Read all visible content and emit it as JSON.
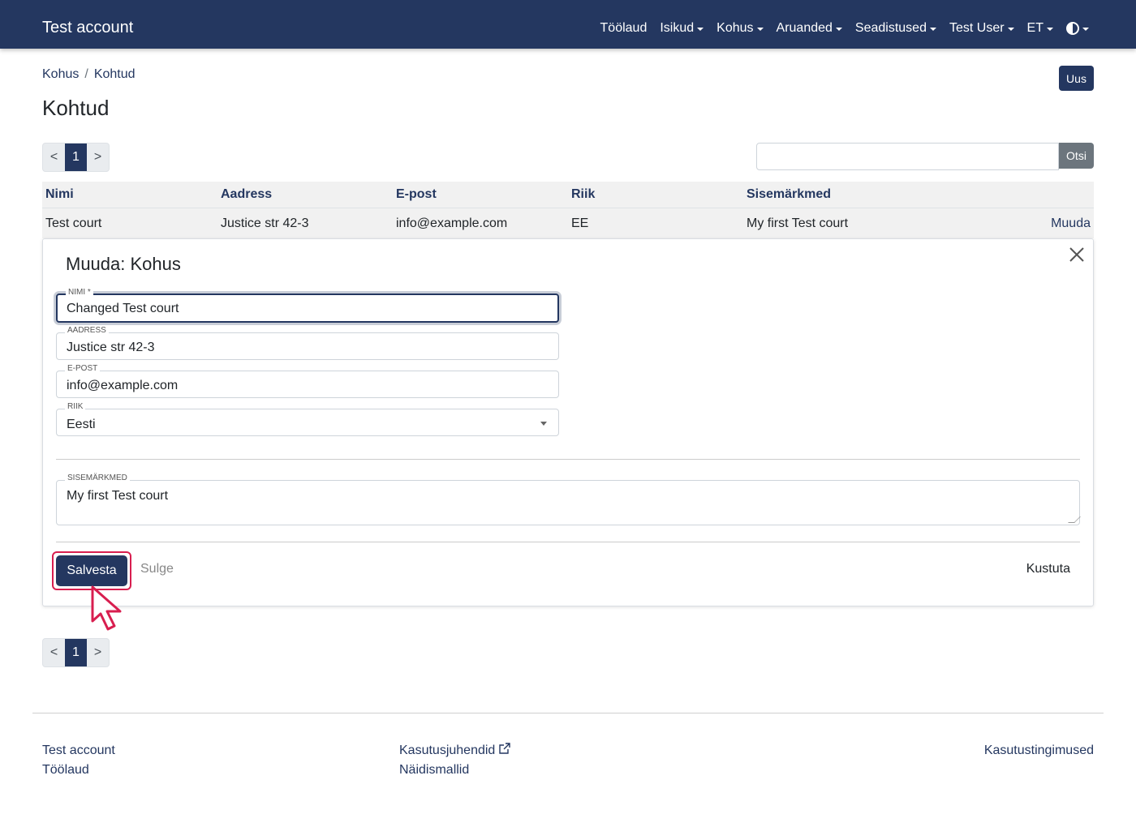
{
  "navbar": {
    "brand": "Test account",
    "items": [
      "Töölaud",
      "Isikud",
      "Kohus",
      "Aruanded",
      "Seadistused",
      "Test User",
      "ET"
    ]
  },
  "breadcrumb": [
    "Kohus",
    "Kohtud"
  ],
  "page_title": "Kohtud",
  "new_button": "Uus",
  "pagination": {
    "prev": "<",
    "page": "1",
    "next": ">"
  },
  "search": {
    "value": "",
    "button": "Otsi"
  },
  "table": {
    "headers": [
      "Nimi",
      "Aadress",
      "E-post",
      "Riik",
      "Sisemärkmed"
    ],
    "row": {
      "name": "Test court",
      "address": "Justice str 42-3",
      "email": "info@example.com",
      "country": "EE",
      "notes": "My first Test court",
      "action": "Muuda"
    }
  },
  "edit_panel": {
    "title": "Muuda: Kohus",
    "fields": {
      "name_label": "NIMI *",
      "name_value": "Changed Test court",
      "address_label": "AADRESS",
      "address_value": "Justice str 42-3",
      "email_label": "E-POST",
      "email_value": "info@example.com",
      "country_label": "RIIK",
      "country_value": "Eesti",
      "notes_label": "SISEMÄRKMED",
      "notes_value": "My first Test court"
    },
    "save_button": "Salvesta",
    "close_button": "Sulge",
    "delete_button": "Kustuta"
  },
  "footer": {
    "left": [
      "Test account",
      "Töölaud"
    ],
    "middle": [
      "Kasutusjuhendid",
      "Näidismallid"
    ],
    "right": "Kasutustingimused"
  },
  "colors": {
    "primary": "#243760",
    "highlight": "#d81e4f"
  }
}
